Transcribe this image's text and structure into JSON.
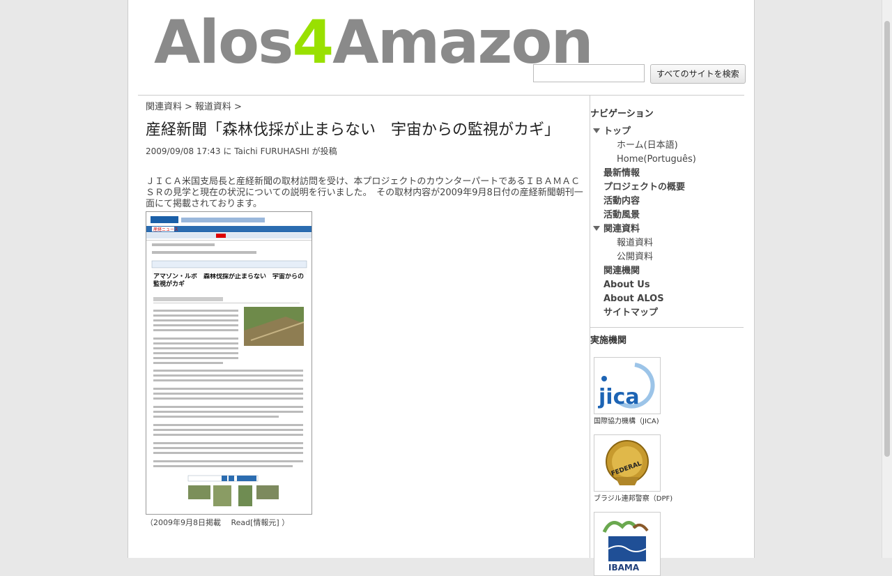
{
  "site": {
    "logo_before": "Alos",
    "logo_accent": "4",
    "logo_after": "Amazon",
    "search_button": "すべてのサイトを検索",
    "search_placeholder": ""
  },
  "breadcrumb": {
    "items": [
      "関連資料",
      "報道資料"
    ],
    "sep": ">"
  },
  "article": {
    "title": "産経新聞「森林伐採が止まらない　宇宙からの監視がカギ」",
    "byline": "2009/09/08 17:43 に Taichi FURUHASHI が投稿",
    "body": "ＪＩＣＡ米国支局長と産経新聞の取材訪問を受け、本プロジェクトのカウンターパートであるＩＢＡＭＡＣＳＲの見学と現在の状況についての説明を行いました。　その取材内容が2009年9月8日付の産経新聞朝刊一面にて掲載されております。",
    "clip_headline": "アマゾン・ルポ　森林伐採が止まらない　宇宙からの監視がカギ",
    "clip_site": "産経ニュース",
    "caption": "（2009年9月8日掲載　 Read[情報元] ）"
  },
  "sidebar": {
    "nav_title": "ナビゲーション",
    "nav": [
      {
        "label": "トップ",
        "level": 1,
        "expanded": true
      },
      {
        "label": "ホーム(日本語)",
        "level": 2
      },
      {
        "label": "Home(Português)",
        "level": 2
      },
      {
        "label": "最新情報",
        "level": 1
      },
      {
        "label": "プロジェクトの概要",
        "level": 1
      },
      {
        "label": "活動内容",
        "level": 1
      },
      {
        "label": "活動風景",
        "level": 1
      },
      {
        "label": "関連資料",
        "level": 1,
        "expanded": true
      },
      {
        "label": "報道資料",
        "level": 2
      },
      {
        "label": "公開資料",
        "level": 2
      },
      {
        "label": "関連機関",
        "level": 1
      },
      {
        "label": "About Us",
        "level": 1
      },
      {
        "label": "About ALOS",
        "level": 1
      },
      {
        "label": "サイトマップ",
        "level": 1
      }
    ],
    "org_title": "実施機関",
    "orgs": [
      {
        "label": "国際協力機構（JICA)",
        "logo_text": "jica"
      },
      {
        "label": "ブラジル連邦警察（DPF)",
        "logo_text": "FEDERAL"
      },
      {
        "label": "",
        "logo_text": "IBAMA"
      }
    ]
  },
  "colors": {
    "logo_gray": "#8a8a8a",
    "logo_accent": "#99e000",
    "jica_blue": "#1d64b4"
  }
}
